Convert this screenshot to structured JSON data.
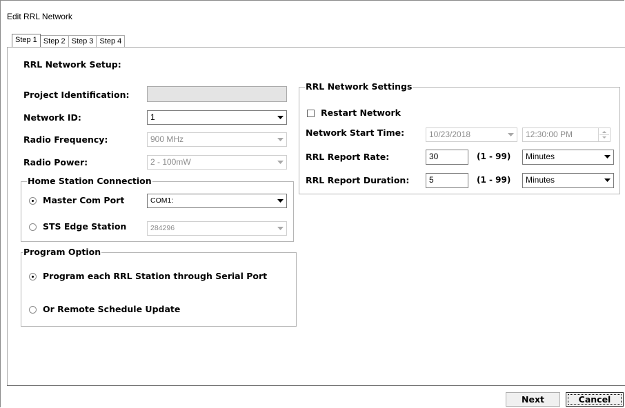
{
  "window": {
    "title": "Edit RRL Network"
  },
  "tabs": [
    {
      "label": "Step 1",
      "active": true
    },
    {
      "label": "Step 2",
      "active": false
    },
    {
      "label": "Step 3",
      "active": false
    },
    {
      "label": "Step 4",
      "active": false
    }
  ],
  "setup": {
    "heading": "RRL Network Setup:",
    "project_id": {
      "label": "Project Identification:",
      "value": ""
    },
    "network_id": {
      "label": "Network ID:",
      "value": "1"
    },
    "radio_frequency": {
      "label": "Radio Frequency:",
      "value": "900 MHz"
    },
    "radio_power": {
      "label": "Radio Power:",
      "value": "2 - 100mW"
    }
  },
  "home_station": {
    "legend": "Home Station Connection",
    "master_com": {
      "label": "Master Com Port",
      "value": "COM1:",
      "selected": true
    },
    "sts_edge": {
      "label": "STS Edge Station",
      "value": "284296",
      "selected": false
    }
  },
  "program_option": {
    "legend": "Program Option",
    "serial": {
      "label": "Program each RRL Station through Serial Port",
      "selected": true
    },
    "remote": {
      "label": "Or Remote Schedule Update",
      "selected": false
    }
  },
  "settings": {
    "legend": "RRL Network Settings",
    "restart": {
      "label": "Restart Network",
      "checked": false
    },
    "start_time": {
      "label": "Network Start Time:",
      "date": "10/23/2018",
      "time": "12:30:00 PM"
    },
    "report_rate": {
      "label": "RRL Report Rate:",
      "value": "30",
      "range": "(1 - 99)",
      "unit": "Minutes"
    },
    "report_duration": {
      "label": "RRL Report Duration:",
      "value": "5",
      "range": "(1 - 99)",
      "unit": "Minutes"
    }
  },
  "buttons": {
    "next": "Next",
    "cancel": "Cancel"
  }
}
